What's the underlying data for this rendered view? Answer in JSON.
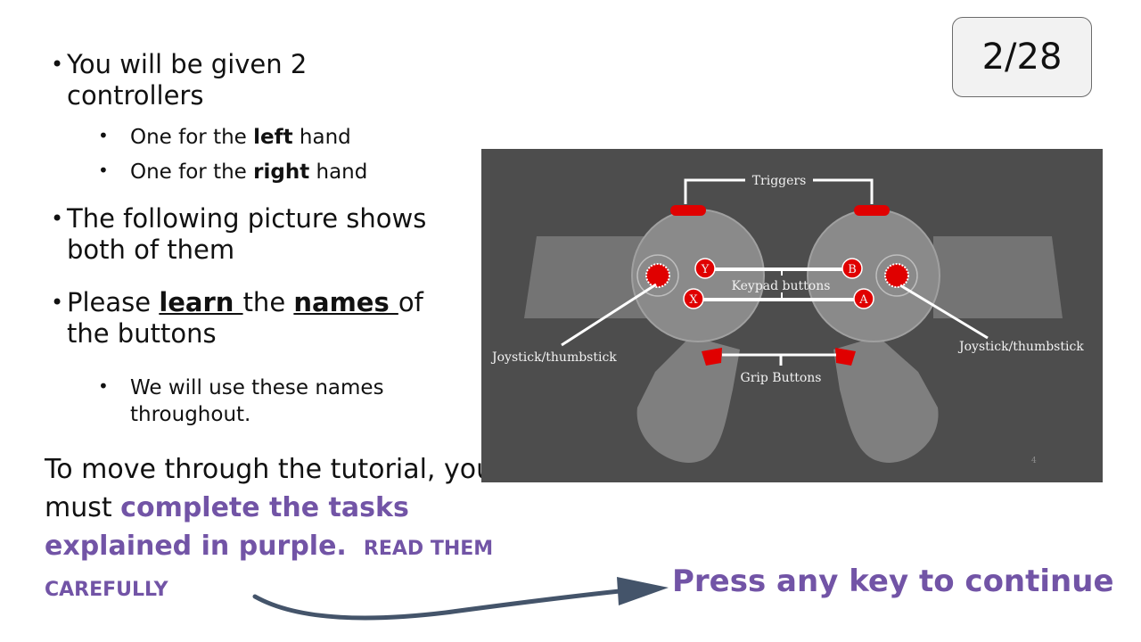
{
  "counter": "2/28",
  "bullets": {
    "b1": "You will be given 2 controllers",
    "b1_1_pre": "One for the ",
    "b1_1_bold": "left",
    "b1_1_post": " hand",
    "b1_2_pre": "One for the ",
    "b1_2_bold": "right",
    "b1_2_post": " hand",
    "b2": "The following picture shows both of them",
    "b3_pre": "Please ",
    "b3_learn": "learn ",
    "b3_mid": "the ",
    "b3_names": "names ",
    "b3_post": "of the buttons",
    "b3_1": "We will use these names throughout."
  },
  "tutorial": {
    "line1": "To move through the tutorial, you must ",
    "purple": "complete the tasks explained in purple.",
    "read": "READ THEM CAREFULLY"
  },
  "press": "Press any key to continue",
  "diagram": {
    "triggers": "Triggers",
    "keypad": "Keypad buttons",
    "grip": "Grip Buttons",
    "joystick_left": "Joystick/thumbstick",
    "joystick_right": "Joystick/thumbstick",
    "btn_y": "Y",
    "btn_x": "X",
    "btn_b": "B",
    "btn_a": "A",
    "page_num": "4"
  },
  "colors": {
    "purple": "#7254a6",
    "button_red": "#e00000",
    "controller_gray": "#8a8a8a",
    "background_gray": "#4d4d4d"
  }
}
